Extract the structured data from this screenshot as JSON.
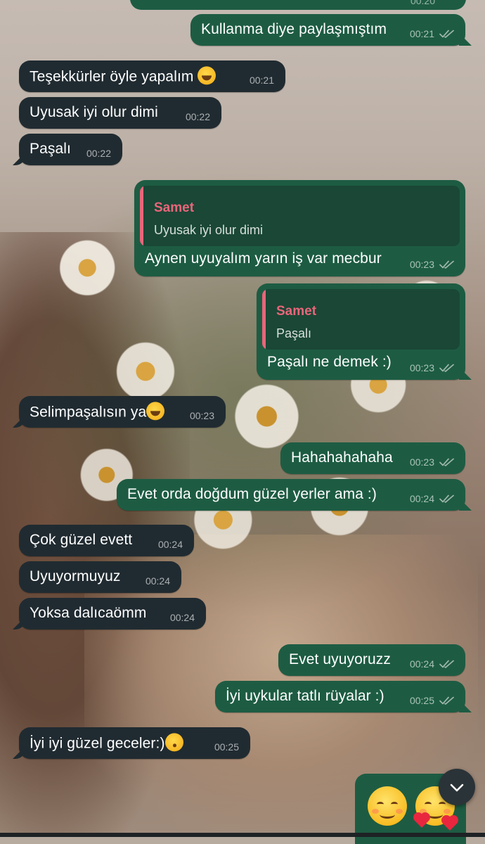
{
  "chat": {
    "top_partial_time": "00:20",
    "messages": [
      {
        "dir": "out",
        "text": "Kullanma diye paylaşmıştım",
        "time": "00:21"
      },
      {
        "dir": "in",
        "text": "Teşekkürler öyle yapalım",
        "emoji": "rolling-on-floor-laughing",
        "time": "00:21"
      },
      {
        "dir": "in",
        "text": "Uyusak iyi olur dimi",
        "time": "00:22"
      },
      {
        "dir": "in",
        "text": "Paşalı",
        "time": "00:22"
      },
      {
        "dir": "out",
        "reply_name": "Samet",
        "reply_text": "Uyusak iyi olur dimi",
        "text": "Aynen uyuyalım yarın iş var mecbur",
        "time": "00:23"
      },
      {
        "dir": "out",
        "reply_name": "Samet",
        "reply_text": "Paşalı",
        "text": "Paşalı ne demek :)",
        "time": "00:23"
      },
      {
        "dir": "in",
        "text": "Selimpaşalısın ya",
        "emoji": "rolling-on-floor-laughing",
        "time": "00:23"
      },
      {
        "dir": "out",
        "text": "Hahahahahaha",
        "time": "00:23"
      },
      {
        "dir": "out",
        "text": "Evet orda doğdum güzel yerler ama :)",
        "time": "00:24"
      },
      {
        "dir": "in",
        "text": "Çok güzel evett",
        "time": "00:24"
      },
      {
        "dir": "in",
        "text": "Uyuyormuyuz",
        "time": "00:24"
      },
      {
        "dir": "in",
        "text": "Yoksa dalıcaömm",
        "time": "00:24"
      },
      {
        "dir": "out",
        "text": "Evet uyuyoruzz",
        "time": "00:24"
      },
      {
        "dir": "out",
        "text": "İyi uykular tatlı rüyalar :)",
        "time": "00:25"
      },
      {
        "dir": "in",
        "text": "İyi iyi güzel geceler:)",
        "emoji": "face-blowing-kiss",
        "time": "00:25"
      }
    ],
    "last_emoji_message": [
      "smiling-face-icon",
      "smiling-face-with-hearts-icon"
    ]
  },
  "colors": {
    "incoming_bubble": "#202b31",
    "outgoing_bubble": "#1d5c43",
    "reply_name": "#e8667a",
    "read_ticks": "#9fb7ad"
  },
  "scroll_button": {
    "icon": "chevron-down-icon"
  }
}
